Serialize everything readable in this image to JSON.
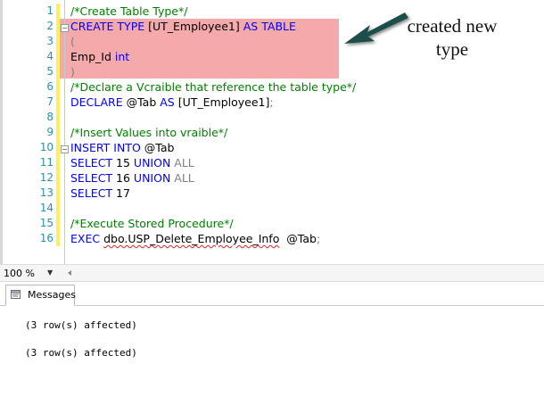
{
  "editor": {
    "line_numbers": [
      "1",
      "2",
      "3",
      "4",
      "5",
      "6",
      "7",
      "8",
      "9",
      "10",
      "11",
      "12",
      "13",
      "14",
      "15",
      "16"
    ],
    "lines": [
      [
        {
          "t": "/*Create Table Type*/",
          "c": "cm"
        }
      ],
      [
        {
          "t": "CREATE",
          "c": "kw"
        },
        {
          "t": " "
        },
        {
          "t": "TYPE",
          "c": "kw"
        },
        {
          "t": " [UT_Employee1] "
        },
        {
          "t": "AS",
          "c": "kw"
        },
        {
          "t": " "
        },
        {
          "t": "TABLE",
          "c": "kw"
        }
      ],
      [
        {
          "t": "(",
          "c": "gr"
        }
      ],
      [
        {
          "t": "Emp_Id "
        },
        {
          "t": "int",
          "c": "kw"
        }
      ],
      [
        {
          "t": ")",
          "c": "gr"
        }
      ],
      [
        {
          "t": "/*Declare a Vcraible that reference the table type*/",
          "c": "cm"
        }
      ],
      [
        {
          "t": "DECLARE",
          "c": "kw"
        },
        {
          "t": " @Tab "
        },
        {
          "t": "AS",
          "c": "kw"
        },
        {
          "t": " [UT_Employee1]"
        },
        {
          "t": ";",
          "c": "gr"
        }
      ],
      [],
      [
        {
          "t": "/*Insert Values into vraible*/",
          "c": "cm"
        }
      ],
      [
        {
          "t": "INSERT",
          "c": "kw"
        },
        {
          "t": " "
        },
        {
          "t": "INTO",
          "c": "kw"
        },
        {
          "t": " @Tab"
        }
      ],
      [
        {
          "t": "SELECT",
          "c": "kw"
        },
        {
          "t": " 15 "
        },
        {
          "t": "UNION",
          "c": "kw"
        },
        {
          "t": " "
        },
        {
          "t": "ALL",
          "c": "gr"
        }
      ],
      [
        {
          "t": "SELECT",
          "c": "kw"
        },
        {
          "t": " 16 "
        },
        {
          "t": "UNION",
          "c": "kw"
        },
        {
          "t": " "
        },
        {
          "t": "ALL",
          "c": "gr"
        }
      ],
      [
        {
          "t": "SELECT",
          "c": "kw"
        },
        {
          "t": " 17"
        }
      ],
      [],
      [
        {
          "t": "/*Execute Stored Procedure*/",
          "c": "cm"
        }
      ],
      [
        {
          "t": "EXEC",
          "c": "kw"
        },
        {
          "t": " "
        },
        {
          "t": "dbo.USP_Delete_Employee_Info",
          "c": "squig"
        },
        {
          "t": "  @Tab"
        },
        {
          "t": ";",
          "c": "gr"
        }
      ]
    ]
  },
  "annotation": {
    "line1": "created new",
    "line2": "type"
  },
  "zoom": {
    "value": "100 %"
  },
  "results": {
    "tab_label": "Messages",
    "messages": [
      "(3 row(s) affected)",
      "(3 row(s) affected)"
    ]
  },
  "colors": {
    "keyword": "#0000ff",
    "comment": "#008000",
    "gray": "#808080",
    "highlight": "#f4a9ab",
    "line_number": "#2b91af",
    "arrow": "#1f4f4a"
  }
}
